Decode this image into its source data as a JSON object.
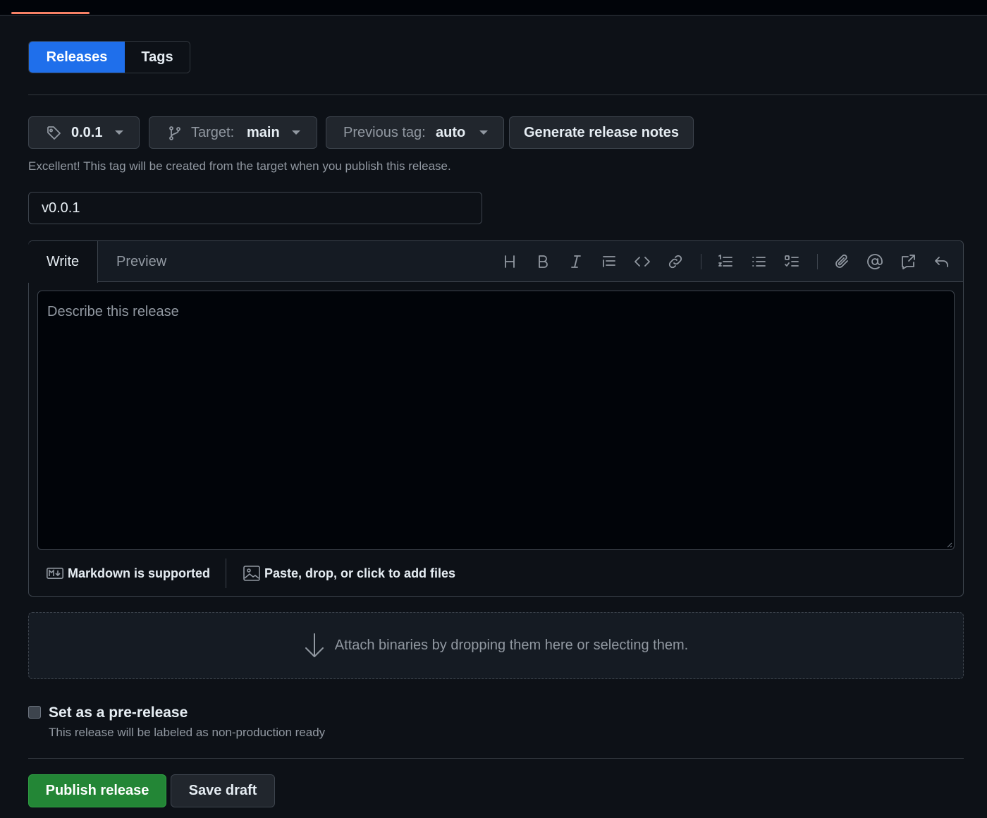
{
  "nav": {
    "releases_label": "Releases",
    "tags_label": "Tags"
  },
  "tag_selector": {
    "value": "0.0.1"
  },
  "target_selector": {
    "label": "Target:",
    "value": "main"
  },
  "previous_tag_selector": {
    "label": "Previous tag:",
    "value": "auto"
  },
  "generate_notes_label": "Generate release notes",
  "tag_hint": "Excellent! This tag will be created from the target when you publish this release.",
  "release_title": {
    "value": "v0.0.1"
  },
  "editor": {
    "write_tab": "Write",
    "preview_tab": "Preview",
    "toolbar": [
      "heading-icon",
      "bold-icon",
      "italic-icon",
      "quote-icon",
      "code-icon",
      "link-icon",
      "numbered-list-icon",
      "bulleted-list-icon",
      "task-list-icon",
      "attach-icon",
      "mention-icon",
      "reference-icon",
      "undo-icon"
    ],
    "placeholder": "Describe this release",
    "markdown_label": "Markdown is supported",
    "files_label": "Paste, drop, or click to add files"
  },
  "binaries_label": "Attach binaries by dropping them here or selecting them.",
  "prerelease": {
    "checked": false,
    "title": "Set as a pre-release",
    "description": "This release will be labeled as non-production ready"
  },
  "actions": {
    "publish_label": "Publish release",
    "draft_label": "Save draft"
  },
  "colors": {
    "accent": "#1f6feb",
    "publish": "#238636",
    "background": "#0d1117"
  }
}
